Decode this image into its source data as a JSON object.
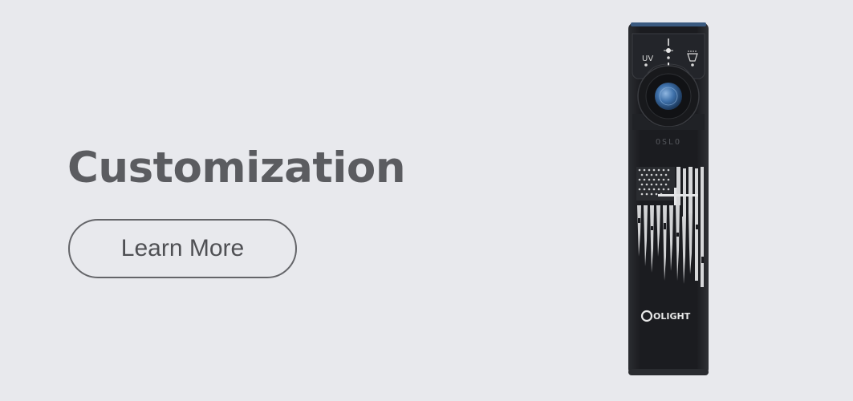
{
  "banner": {
    "headline": "Customization",
    "cta_label": "Learn More",
    "colors": {
      "background": "#e8e9ed",
      "headline": "#5b5c60",
      "button_border": "#646569",
      "product_body": "#1e2024",
      "button_blue": "#3d6fa8"
    }
  },
  "product": {
    "mode_labels": [
      "UV",
      "",
      ""
    ],
    "engraving_label": "OSLO",
    "brand_logo": "OLIGHT",
    "icons": [
      "uv-mode-icon",
      "white-light-icon",
      "floodlight-icon",
      "flag-engraving-icon",
      "olight-logo-icon"
    ]
  }
}
